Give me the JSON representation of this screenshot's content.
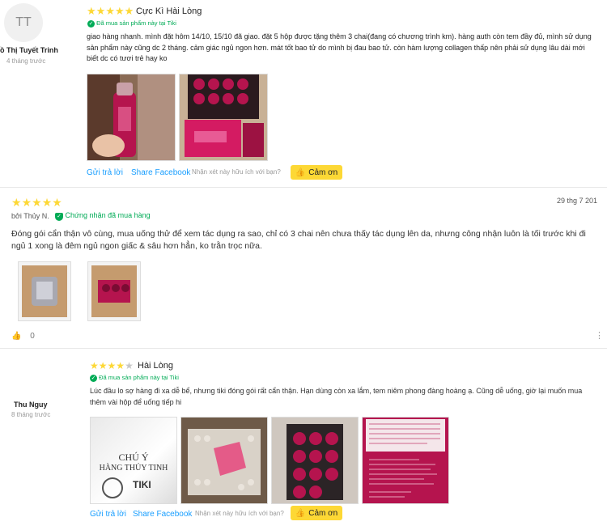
{
  "review1": {
    "avatar_initials": "TT",
    "reviewer": "ồ Thị Tuyết Trinh",
    "time": "4 tháng trước",
    "stars": 5,
    "title": "Cực Kì Hài Lòng",
    "verified": "Đã mua sản phẩm này tại Tiki",
    "body": "giao hàng nhanh. mình đặt hôm 14/10, 15/10 đã giao. đặt 5 hộp được tặng thêm 3 chai(đang có chương trình km). hàng auth còn tem đầy đủ, mình sử dụng sản phẩm này cũng dc 2 tháng. cảm giác ngủ ngon hơn. mát tốt bao tử do mình bị đau bao tử. còn hàm lượng collagen thấp nên phải sử dụng lâu dài mới biết dc có tươi trẻ hay ko",
    "reply": "Gửi trả lời",
    "share": "Share Facebook",
    "helpful_q": "Nhận xét này hữu ích với bạn?",
    "thanks": "Cảm ơn"
  },
  "review2": {
    "stars": 5,
    "date": "29 thg 7 201",
    "by": "bởi Thủy N.",
    "verified": "Chứng nhận đã mua hàng",
    "body": "Đóng gói cẩn thận vô cùng, mua uống thử để xem tác dụng ra sao, chỉ có 3 chai nên chưa thấy tác dụng lên da, nhưng công nhận luôn là tối trước khi đi ngủ 1 xong là đêm ngủ ngon giấc & sâu hơn hẳn, ko trằn trọc nữa.",
    "likes": "0"
  },
  "review3": {
    "reviewer": "Thu Nguy",
    "time": "8 tháng trước",
    "stars": 4,
    "title": "Hài Lòng",
    "verified": "Đã mua sản phẩm này tại Tiki",
    "body": "Lúc đầu lo sợ hàng đi xa dễ bể, nhưng tiki đóng gói rất cẩn thận. Hạn dùng còn xa lắm, tem niêm phong đàng hoàng ạ. Cũng dễ uống, giờ lại muốn mua thêm vài hộp để uống tiếp hi",
    "sign_line1": "CHÚ Ý",
    "sign_line2": "HÀNG THỦY TINH",
    "sign_brand": "TIKI",
    "reply": "Gửi trả lời",
    "share": "Share Facebook",
    "helpful_q": "Nhận xét này hữu ích với bạn?",
    "thanks": "Cảm ơn"
  },
  "colors": {
    "star": "#fdd836",
    "green": "#00ab56",
    "link": "#189eff",
    "thanks_bg": "#fdd835",
    "product": "#b5144e"
  }
}
